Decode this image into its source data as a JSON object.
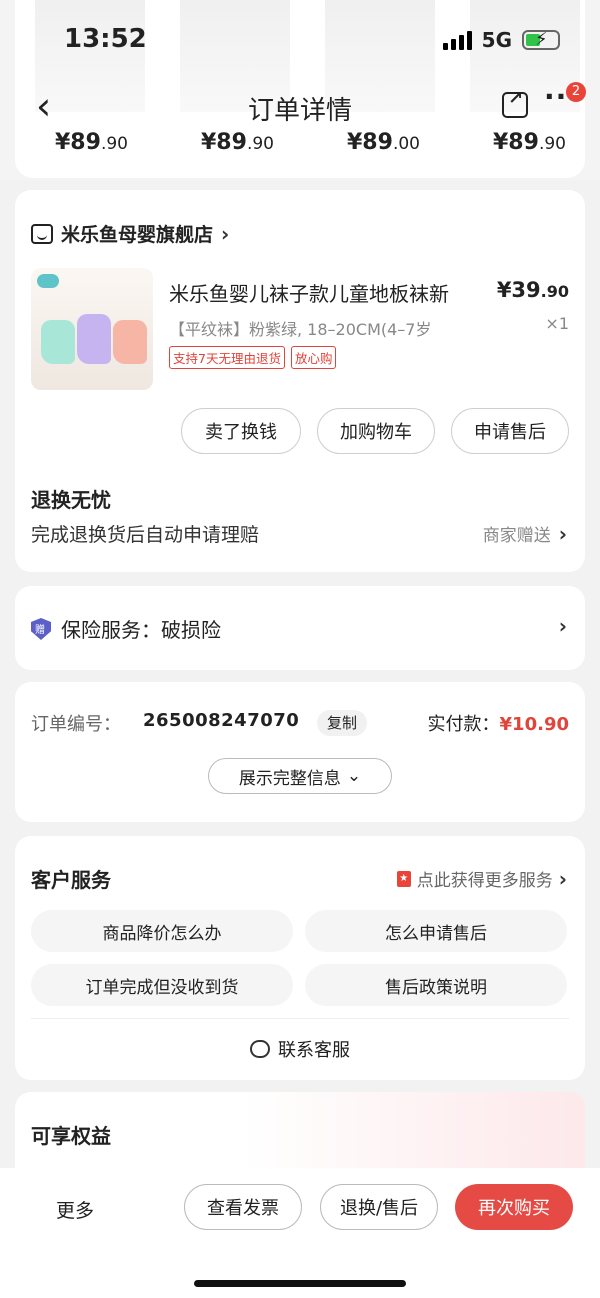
{
  "status_bar": {
    "time": "13:52",
    "network": "5G"
  },
  "nav": {
    "title": "订单详情",
    "badge_count": "2"
  },
  "recommend_prices": [
    {
      "main": "¥89",
      "decimal": ".90"
    },
    {
      "main": "¥89",
      "decimal": ".90"
    },
    {
      "main": "¥89",
      "decimal": ".00"
    },
    {
      "main": "¥89",
      "decimal": ".90"
    }
  ],
  "order_card": {
    "shop_name": "米乐鱼母婴旗舰店",
    "product": {
      "title": "米乐鱼婴儿袜子款儿童地板袜新",
      "price_main": "¥39",
      "price_decimal": ".90",
      "spec": "【平纹袜】粉紫绿, 18–20CM(4–7岁",
      "quantity": "×1",
      "tags": [
        "支持7天无理由退货",
        "放心购"
      ]
    },
    "buttons": [
      "卖了换钱",
      "加购物车",
      "申请售后"
    ],
    "worry_free": {
      "title": "退换无忧",
      "description": "完成退换货后自动申请理赔",
      "note": "商家赠送"
    }
  },
  "insurance": {
    "icon_text": "赠",
    "text": "保险服务：破损险"
  },
  "order_info": {
    "label": "订单编号：",
    "number": "265008247070",
    "copy_label": "复制",
    "paid_label": "实付款：",
    "paid_amount": "¥10.90",
    "show_all_label": "展示完整信息"
  },
  "customer_service": {
    "title": "客户服务",
    "more_label": "点此获得更多服务",
    "items": [
      "商品降价怎么办",
      "怎么申请售后",
      "订单完成但没收到货",
      "售后政策说明"
    ],
    "contact_label": "联系客服"
  },
  "benefits": {
    "title": "可享权益"
  },
  "bottom_bar": {
    "more_label": "更多",
    "buttons": [
      "查看发票",
      "退换/售后",
      "再次购买"
    ]
  },
  "colors": {
    "accent_red": "#e64a45",
    "price_red": "#e0443b",
    "insurance_blue": "#5b5fc7"
  }
}
